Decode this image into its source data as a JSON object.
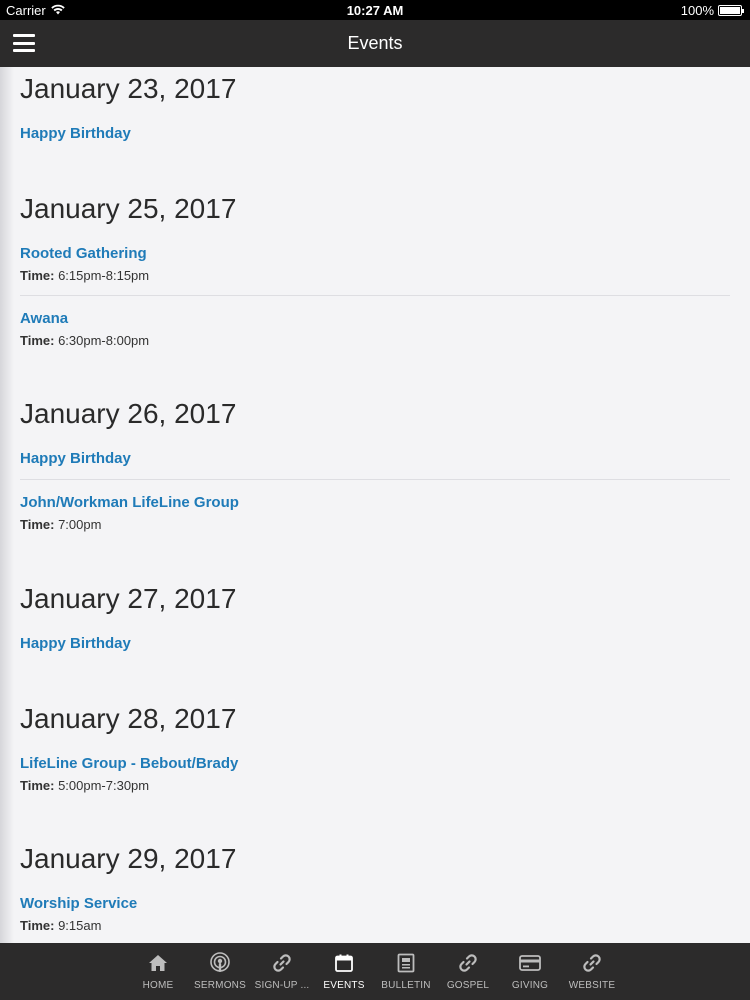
{
  "status_bar": {
    "carrier": "Carrier",
    "time": "10:27 AM",
    "battery": "100%",
    "battery_level": 1.0
  },
  "nav": {
    "title": "Events"
  },
  "days": [
    {
      "date": "January 23, 2017",
      "events": [
        {
          "title": "Happy Birthday",
          "time_label": "",
          "time": ""
        }
      ]
    },
    {
      "date": "January 25, 2017",
      "events": [
        {
          "title": "Rooted Gathering",
          "time_label": "Time:",
          "time": "6:15pm-8:15pm"
        },
        {
          "title": "Awana",
          "time_label": "Time:",
          "time": "6:30pm-8:00pm"
        }
      ]
    },
    {
      "date": "January 26, 2017",
      "events": [
        {
          "title": "Happy Birthday",
          "time_label": "",
          "time": ""
        },
        {
          "title": "John/Workman LifeLine Group",
          "time_label": "Time:",
          "time": "7:00pm"
        }
      ]
    },
    {
      "date": "January 27, 2017",
      "events": [
        {
          "title": "Happy Birthday",
          "time_label": "",
          "time": ""
        }
      ]
    },
    {
      "date": "January 28, 2017",
      "events": [
        {
          "title": "LifeLine Group - Bebout/Brady",
          "time_label": "Time:",
          "time": "5:00pm-7:30pm"
        }
      ]
    },
    {
      "date": "January 29, 2017",
      "events": [
        {
          "title": "Worship Service",
          "time_label": "Time:",
          "time": "9:15am"
        }
      ]
    }
  ],
  "tabs": [
    {
      "label": "HOME",
      "icon": "home-icon",
      "active": false
    },
    {
      "label": "SERMONS",
      "icon": "podcast-icon",
      "active": false
    },
    {
      "label": "SIGN-UP ...",
      "icon": "link-icon",
      "active": false
    },
    {
      "label": "EVENTS",
      "icon": "calendar-icon",
      "active": true
    },
    {
      "label": "BULLETIN",
      "icon": "document-icon",
      "active": false
    },
    {
      "label": "GOSPEL",
      "icon": "link-icon",
      "active": false
    },
    {
      "label": "GIVING",
      "icon": "credit-card-icon",
      "active": false
    },
    {
      "label": "WEBSITE",
      "icon": "link-icon",
      "active": false
    }
  ],
  "colors": {
    "link": "#1f7bb8",
    "bar": "#2c2b2b",
    "background": "#f4f4f6"
  }
}
